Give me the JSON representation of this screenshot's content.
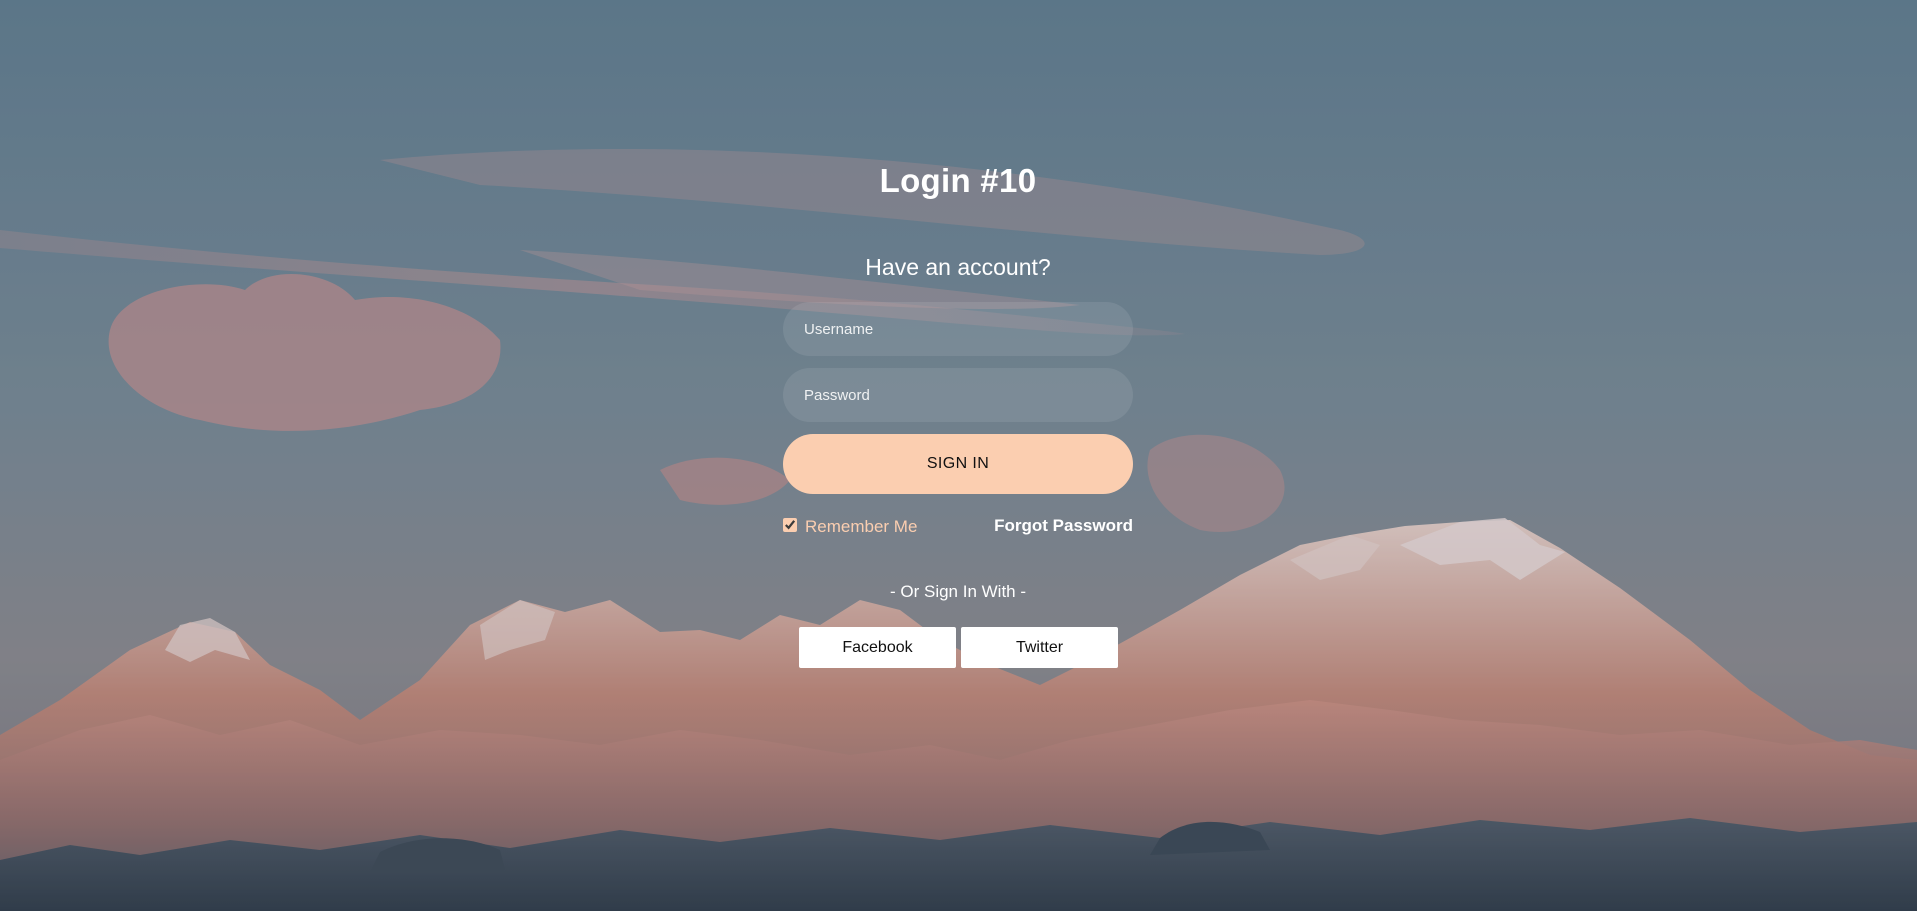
{
  "login": {
    "title": "Login #10",
    "subtitle": "Have an account?",
    "username_placeholder": "Username",
    "password_placeholder": "Password",
    "signin_label": "SIGN IN",
    "remember_label": "Remember Me",
    "remember_checked": true,
    "forgot_label": "Forgot Password",
    "or_text": "- Or Sign In With -",
    "facebook_label": "Facebook",
    "twitter_label": "Twitter"
  },
  "colors": {
    "accent": "#fbceb0",
    "sky": "#6b8595",
    "text": "#ffffff"
  }
}
